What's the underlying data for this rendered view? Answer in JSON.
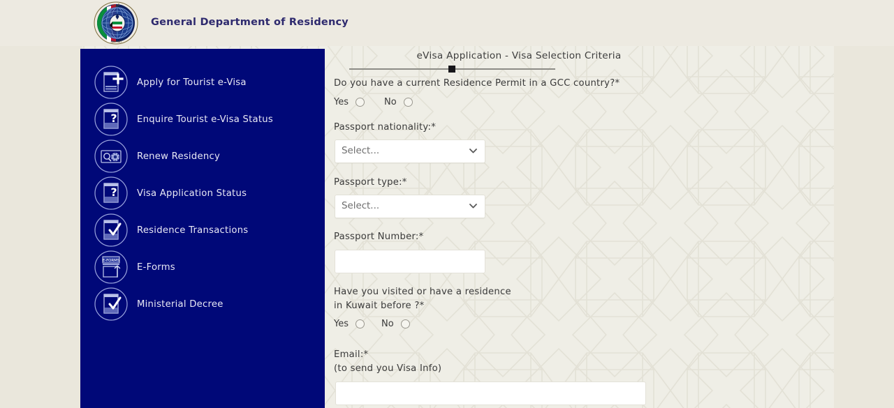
{
  "header": {
    "title": "General Department of Residency",
    "logo_icon": "kuwait-moi-emblem"
  },
  "colors": {
    "sidebar_bg": "#000878",
    "page_bg": "#efeee6",
    "header_bg": "#edeae1",
    "title_text": "#2e2a6e",
    "field_bg": "#ffffff"
  },
  "sidebar": {
    "items": [
      {
        "label": "Apply for Tourist e-Visa",
        "icon": "document-plus-icon"
      },
      {
        "label": "Enquire Tourist e-Visa Status",
        "icon": "document-question-icon"
      },
      {
        "label": "Renew Residency",
        "icon": "id-card-renew-icon"
      },
      {
        "label": "Visa Application Status",
        "icon": "document-question-icon"
      },
      {
        "label": "Residence Transactions",
        "icon": "document-check-icon"
      },
      {
        "label": "E-Forms",
        "icon": "eforms-upload-icon"
      },
      {
        "label": "Ministerial Decree",
        "icon": "document-check-icon"
      }
    ]
  },
  "form": {
    "title": "eVisa Application - Visa Selection Criteria",
    "progress_percent": 48,
    "gcc_question": {
      "label": "Do you have a current Residence Permit in a GCC country?*",
      "yes_label": "Yes",
      "no_label": "No",
      "selected": ""
    },
    "passport_nationality": {
      "label": "Passport nationality:*",
      "value": "Select...",
      "options": [
        "Select..."
      ]
    },
    "passport_type": {
      "label": "Passport type:*",
      "value": "Select...",
      "options": [
        "Select..."
      ]
    },
    "passport_number": {
      "label": "Passport Number:*",
      "value": "",
      "placeholder": ""
    },
    "kuwait_question": {
      "label": "Have you visited or have a residence in Kuwait before ?*",
      "yes_label": "Yes",
      "no_label": "No",
      "selected": ""
    },
    "email": {
      "label": "Email:*",
      "hint": "(to send you Visa Info)",
      "value": "",
      "placeholder": ""
    }
  }
}
